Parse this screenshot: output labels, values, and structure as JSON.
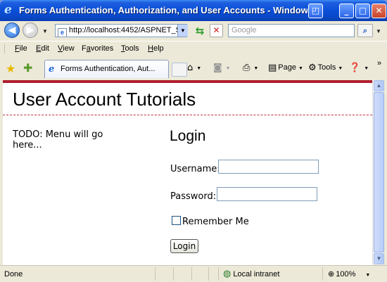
{
  "window": {
    "title": "Forms Authentication, Authorization, and User Accounts - Windows Inter",
    "controls": {
      "restore": "◰",
      "minimize": "_",
      "maximize": "□",
      "close": "✕"
    }
  },
  "address": {
    "url": "http://localhost:4452/ASPNET_Sec",
    "search_placeholder": "Google"
  },
  "menu": {
    "items": [
      {
        "prefix": "",
        "key": "F",
        "rest": "ile"
      },
      {
        "prefix": "",
        "key": "E",
        "rest": "dit"
      },
      {
        "prefix": "",
        "key": "V",
        "rest": "iew"
      },
      {
        "prefix": "F",
        "key": "a",
        "rest": "vorites"
      },
      {
        "prefix": "",
        "key": "T",
        "rest": "ools"
      },
      {
        "prefix": "",
        "key": "H",
        "rest": "elp"
      }
    ]
  },
  "tabs": {
    "active_label": "Forms Authentication, Aut...",
    "page_label": "Page",
    "tools_label": "Tools",
    "overflow": "»"
  },
  "page": {
    "title": "User Account Tutorials",
    "todo": "TODO: Menu will go here...",
    "login_heading": "Login",
    "username_label": "Username:",
    "password_label": "Password:",
    "remember_label": "Remember Me",
    "login_button": "Login"
  },
  "status": {
    "text": "Done",
    "zone": "Local intranet",
    "zoom": "100%"
  }
}
